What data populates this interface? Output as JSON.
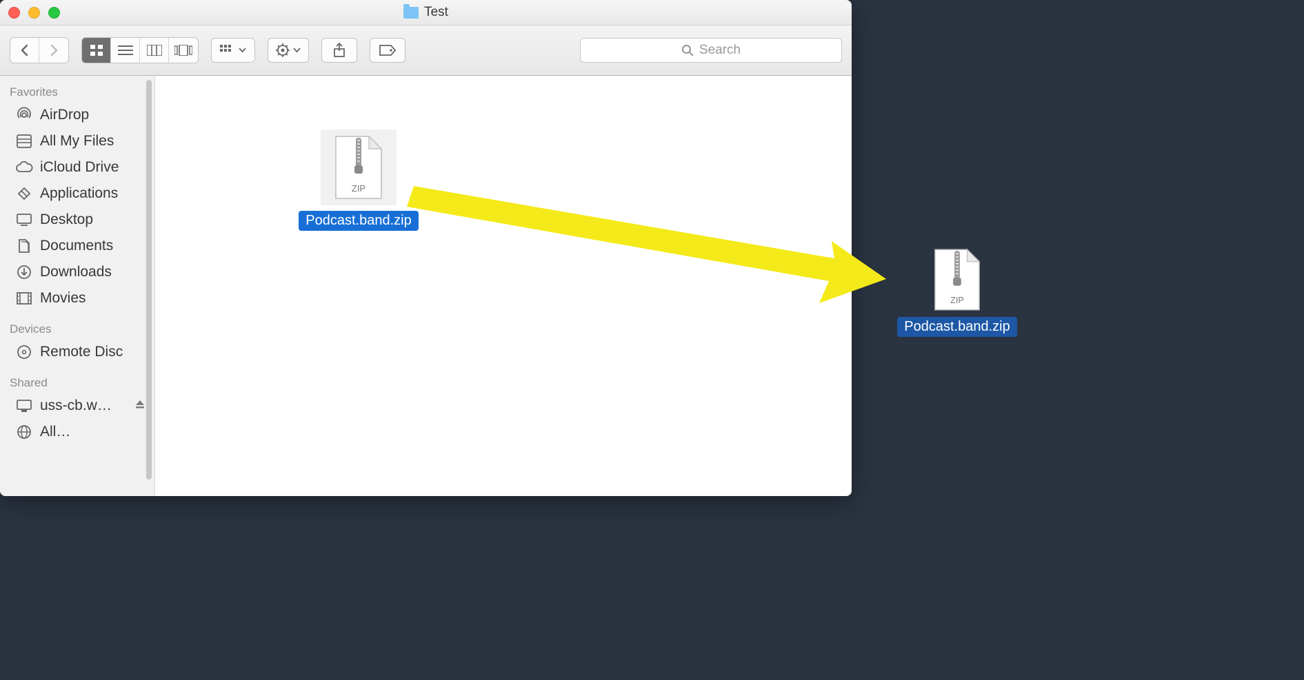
{
  "window": {
    "title": "Test"
  },
  "search": {
    "placeholder": "Search"
  },
  "sidebar": {
    "sections": {
      "favorites": {
        "label": "Favorites",
        "items": [
          {
            "label": "AirDrop"
          },
          {
            "label": "All My Files"
          },
          {
            "label": "iCloud Drive"
          },
          {
            "label": "Applications"
          },
          {
            "label": "Desktop"
          },
          {
            "label": "Documents"
          },
          {
            "label": "Downloads"
          },
          {
            "label": "Movies"
          }
        ]
      },
      "devices": {
        "label": "Devices",
        "items": [
          {
            "label": "Remote Disc"
          }
        ]
      },
      "shared": {
        "label": "Shared",
        "items": [
          {
            "label": "uss-cb.w…",
            "eject": true
          },
          {
            "label": "All…"
          }
        ]
      }
    }
  },
  "content": {
    "file": {
      "name": "Podcast.band.zip",
      "icon_label": "ZIP"
    }
  },
  "desktop": {
    "file": {
      "name": "Podcast.band.zip",
      "icon_label": "ZIP"
    }
  },
  "annotation": {
    "arrow_color": "#f4ea19"
  }
}
